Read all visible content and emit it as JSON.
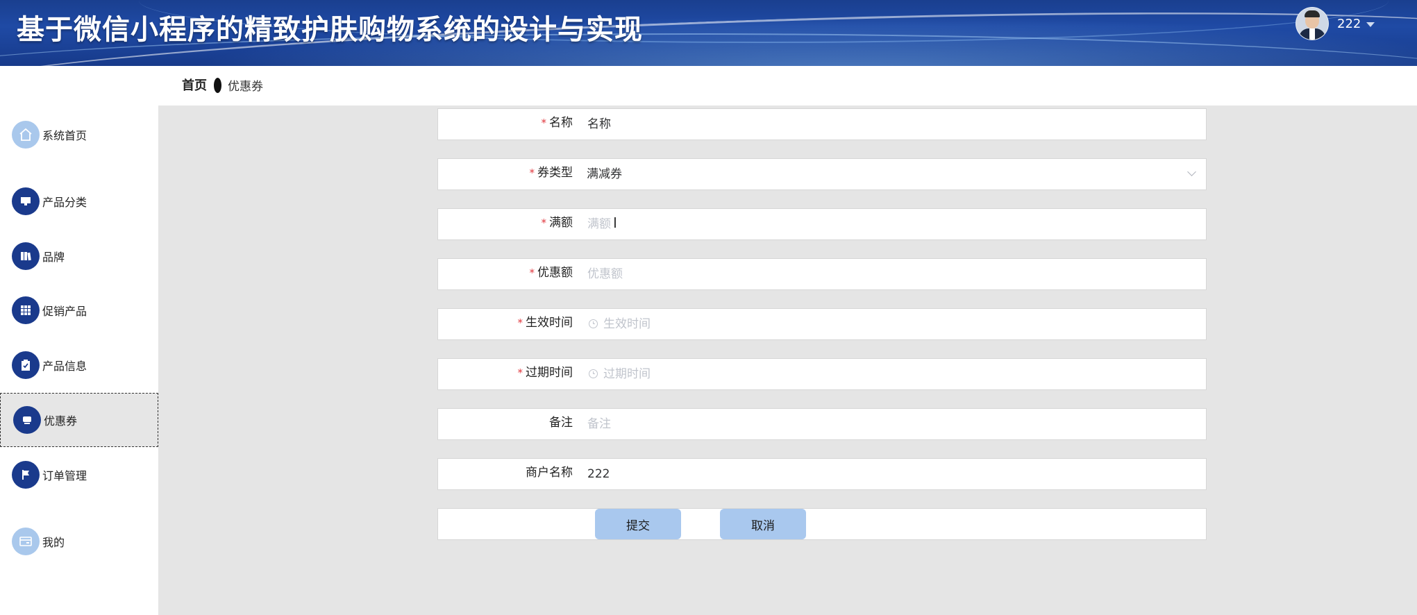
{
  "app": {
    "title": "基于微信小程序的精致护肤购物系统的设计与实现"
  },
  "user": {
    "name": "222",
    "avatar_icon": "user-avatar",
    "dropdown_icon": "caret-down-icon"
  },
  "sidebar": {
    "items": [
      {
        "label": "系统首页",
        "icon": "home-icon"
      },
      {
        "label": "产品分类",
        "icon": "monitor-icon"
      },
      {
        "label": "品牌",
        "icon": "books-icon"
      },
      {
        "label": "促销产品",
        "icon": "grid-icon"
      },
      {
        "label": "产品信息",
        "icon": "clipboard-icon"
      },
      {
        "label": "优惠券",
        "icon": "coupon-icon",
        "active": true
      },
      {
        "label": "订单管理",
        "icon": "flag-icon"
      },
      {
        "label": "我的",
        "icon": "wallet-icon"
      }
    ]
  },
  "breadcrumb": {
    "home": "首页",
    "current": "优惠券"
  },
  "form": {
    "name": {
      "label": "名称",
      "required": true,
      "value": "名称"
    },
    "coupon_type": {
      "label": "券类型",
      "required": true,
      "value": "满减券"
    },
    "full_amount": {
      "label": "满额",
      "required": true,
      "placeholder": "满额"
    },
    "discount_amount": {
      "label": "优惠额",
      "required": true,
      "placeholder": "优惠额"
    },
    "start_time": {
      "label": "生效时间",
      "required": true,
      "placeholder": "生效时间"
    },
    "expire_time": {
      "label": "过期时间",
      "required": true,
      "placeholder": "过期时间"
    },
    "remark": {
      "label": "备注",
      "required": false,
      "placeholder": "备注"
    },
    "merchant": {
      "label": "商户名称",
      "required": false,
      "value": "222"
    },
    "required_mark": "*",
    "submit_label": "提交",
    "cancel_label": "取消"
  },
  "colors": {
    "header": "#1f4aa5",
    "sidebar_icon": "#1a3a8c",
    "sidebar_icon_light": "#a9c8ec",
    "button": "#a9c8ee",
    "required": "#e0383e"
  }
}
